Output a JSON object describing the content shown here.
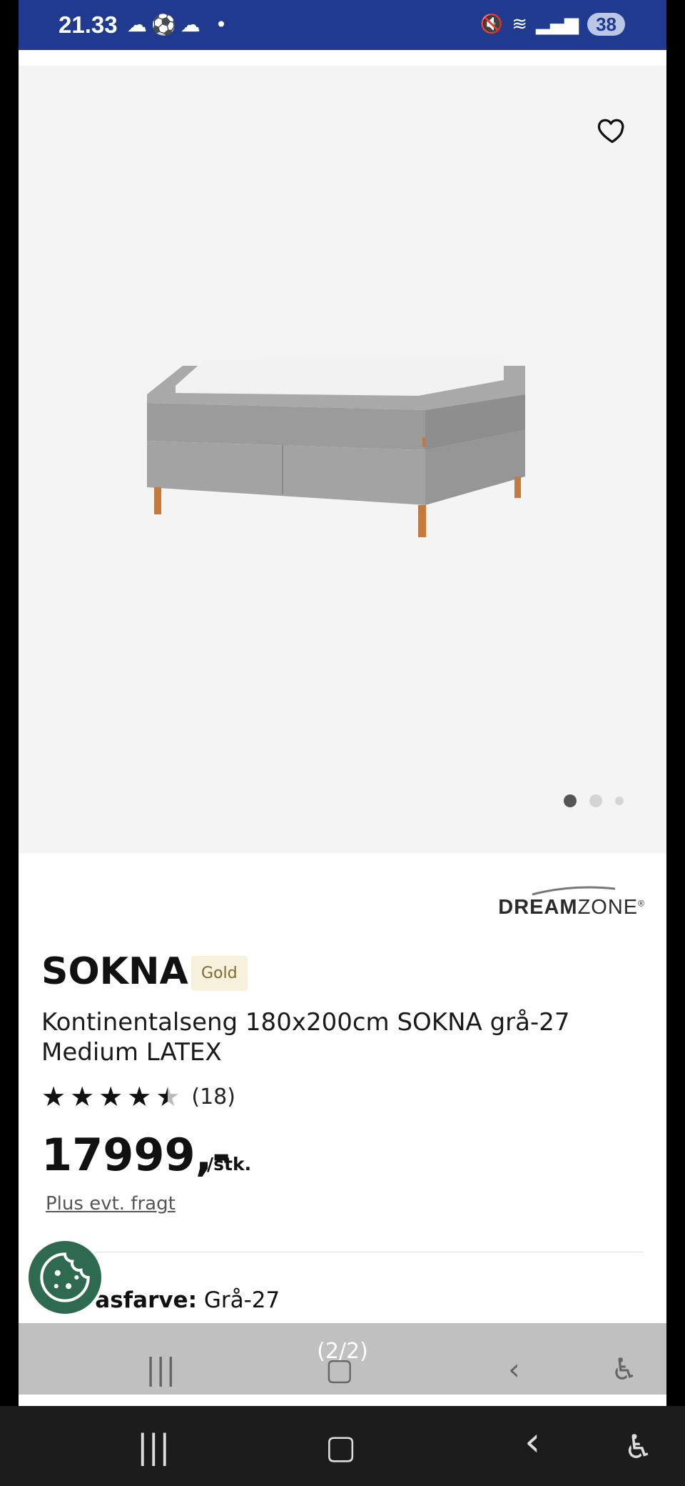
{
  "status": {
    "time": "21.33",
    "left_icons": [
      "weather-icon",
      "football-icon",
      "cloud-icon",
      "dot-icon"
    ],
    "battery": "38"
  },
  "gallery": {
    "favorite_icon": "heart-icon",
    "image_alt": "Kontinentalseng SOKNA grå",
    "dots": 3,
    "active_dot": 1
  },
  "brand": {
    "name_bold": "DREAM",
    "name_regular": "ZONE",
    "mark": "®"
  },
  "product": {
    "name": "SOKNA",
    "tier": "Gold",
    "description": "Kontinentalseng 180x200cm SOKNA grå-27 Medium LATEX",
    "rating": 4.5,
    "rating_count": "(18)",
    "price": "17999,-",
    "unit": "/stk.",
    "freight_link": "Plus evt. fragt",
    "variant_label": "Tekstilfarve:",
    "variant_label_visible": "rasfarve:",
    "variant_value": "Grå-27"
  },
  "overlay": {
    "label": "(2/2)"
  },
  "colors": {
    "statusbar": "#1f3a8e",
    "cookie": "#2d6a4f",
    "tier_bg": "#f6f0dc"
  }
}
